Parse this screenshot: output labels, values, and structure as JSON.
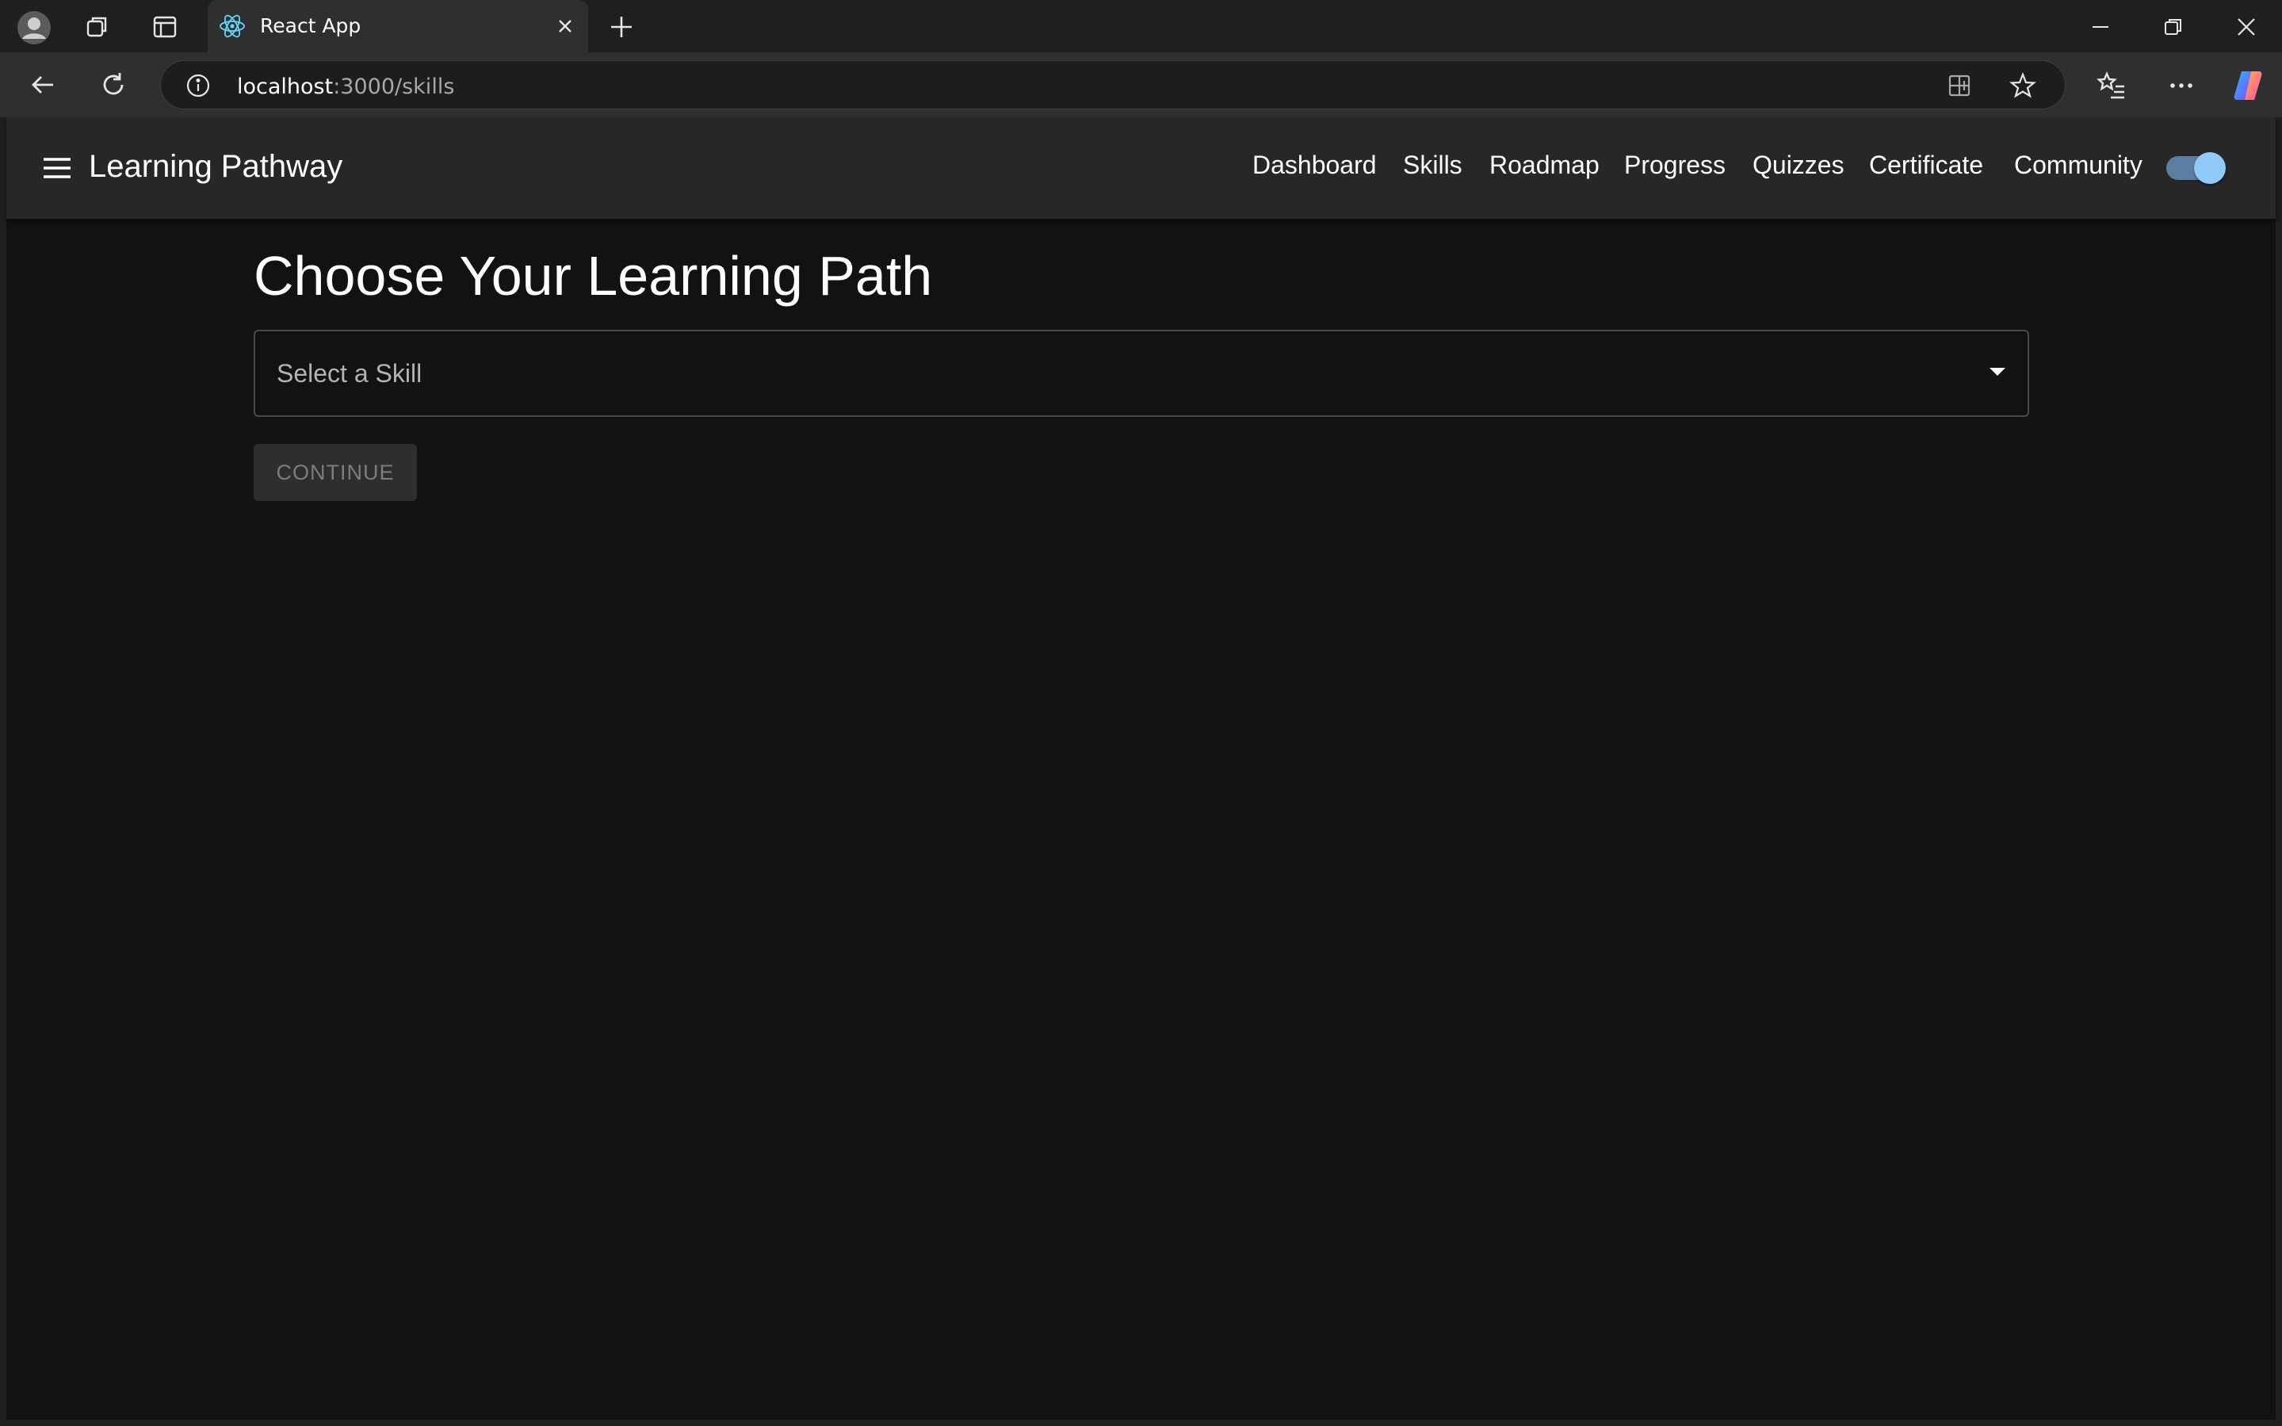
{
  "browser": {
    "tab_title": "React App",
    "address_host": "localhost",
    "address_path": ":3000/skills",
    "icons": [
      "profile-avatar-icon",
      "workspaces-icon",
      "tab-actions-icon",
      "react-favicon-icon",
      "close-icon",
      "new-tab-icon",
      "minimize-icon",
      "restore-icon",
      "window-close-icon",
      "back-icon",
      "refresh-icon",
      "site-info-icon",
      "app-install-icon",
      "favorite-star-icon",
      "favorites-list-icon",
      "more-icon",
      "copilot-icon"
    ]
  },
  "app": {
    "brand": "Learning Pathway",
    "nav": [
      "Dashboard",
      "Skills",
      "Roadmap",
      "Progress",
      "Quizzes",
      "Certificate",
      "Community"
    ],
    "theme_toggle_on": true
  },
  "main": {
    "title": "Choose Your Learning Path",
    "select_label": "Select a Skill",
    "continue_label": "CONTINUE"
  },
  "colors": {
    "page_bg": "#121212",
    "appbar_bg": "#272727",
    "toggle_thumb": "#90caf9",
    "toggle_track": "#5d7ea3"
  }
}
